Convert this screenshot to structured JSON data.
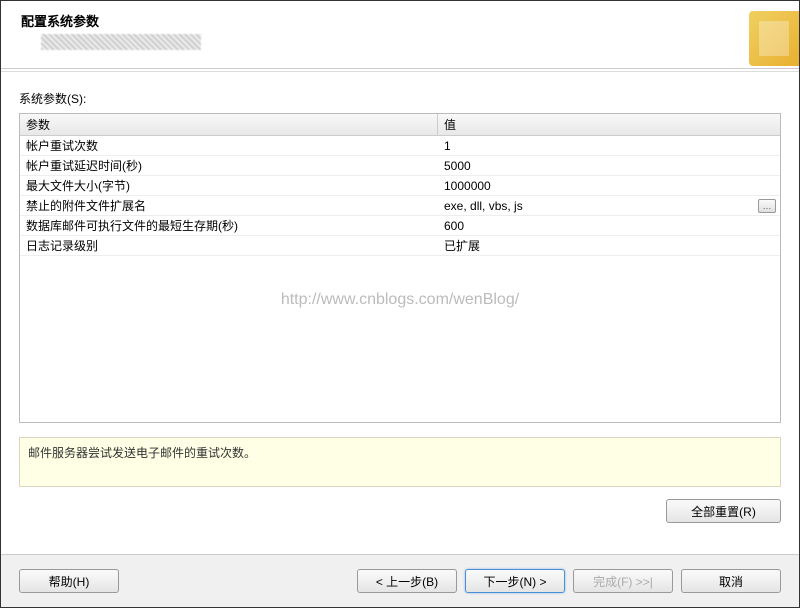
{
  "header": {
    "title": "配置系统参数"
  },
  "content": {
    "label": "系统参数(S):",
    "columns": {
      "param": "参数",
      "value": "值"
    },
    "rows": [
      {
        "param": "帐户重试次数",
        "value": "1",
        "hasButton": false
      },
      {
        "param": "帐户重试延迟时间(秒)",
        "value": "5000",
        "hasButton": false
      },
      {
        "param": "最大文件大小(字节)",
        "value": "1000000",
        "hasButton": false
      },
      {
        "param": "禁止的附件文件扩展名",
        "value": "exe, dll, vbs, js",
        "hasButton": true
      },
      {
        "param": "数据库邮件可执行文件的最短生存期(秒)",
        "value": "600",
        "hasButton": false
      },
      {
        "param": "日志记录级别",
        "value": "已扩展",
        "hasButton": false
      }
    ],
    "description": "邮件服务器尝试发送电子邮件的重试次数。",
    "resetButton": "全部重置(R)"
  },
  "footer": {
    "help": "帮助(H)",
    "back": "< 上一步(B)",
    "next": "下一步(N) >",
    "finish": "完成(F) >>|",
    "cancel": "取消"
  },
  "watermark": "http://www.cnblogs.com/wenBlog/"
}
